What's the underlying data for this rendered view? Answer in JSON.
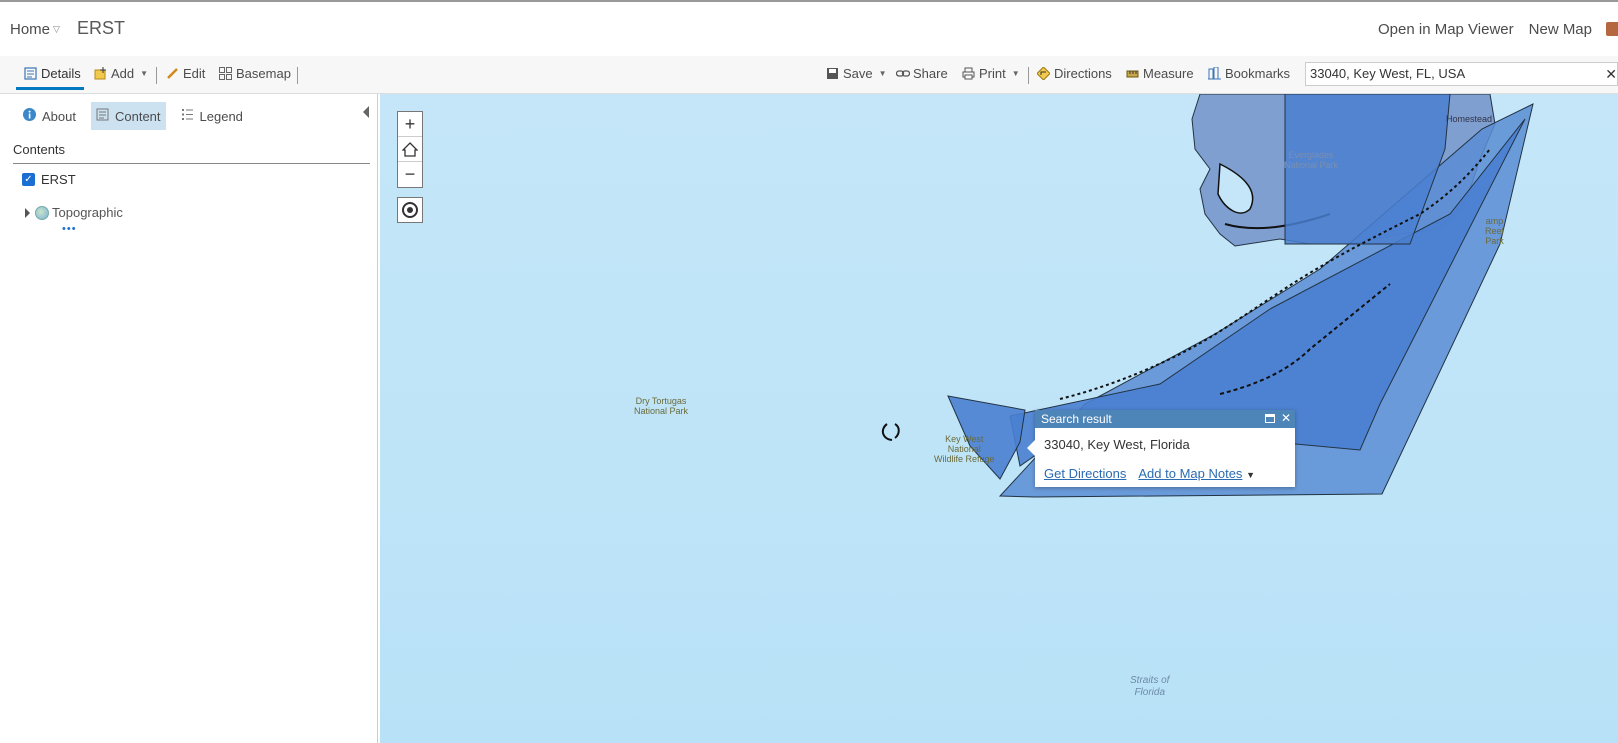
{
  "header": {
    "home_label": "Home",
    "map_title": "ERST",
    "open_in_map_viewer": "Open in Map Viewer",
    "new_map": "New Map"
  },
  "toolbar": {
    "details": "Details",
    "add": "Add",
    "edit": "Edit",
    "basemap": "Basemap",
    "save": "Save",
    "share": "Share",
    "print": "Print",
    "directions": "Directions",
    "measure": "Measure",
    "bookmarks": "Bookmarks",
    "search_value": "33040, Key West, FL, USA"
  },
  "sidebar": {
    "tabs": [
      {
        "label": "About",
        "icon": "info-icon"
      },
      {
        "label": "Content",
        "icon": "content-icon",
        "active": true
      },
      {
        "label": "Legend",
        "icon": "legend-icon"
      }
    ],
    "contents_heading": "Contents",
    "layers": [
      {
        "label": "ERST",
        "checked": true
      }
    ],
    "basemap_layer": "Topographic",
    "more": "•••"
  },
  "map": {
    "labels": {
      "dry_tortugas": "Dry Tortugas\nNational Park",
      "key_west_refuge": "Key West\nNational\nWildlife Refuge",
      "everglades": "Everglades\nNational Park",
      "reef": "amp\nReef\nPark",
      "homestead": "Homestead",
      "straits": "Straits of\nFlorida"
    }
  },
  "popup": {
    "title": "Search result",
    "address": "33040, Key West, Florida",
    "get_directions": "Get Directions",
    "add_to_map_notes": "Add to Map Notes"
  },
  "colors": {
    "accent": "#0079c1",
    "popup_header": "#4e85b8",
    "polygon_fill": "#4a7fd0",
    "sea": "#c4e6f8"
  }
}
